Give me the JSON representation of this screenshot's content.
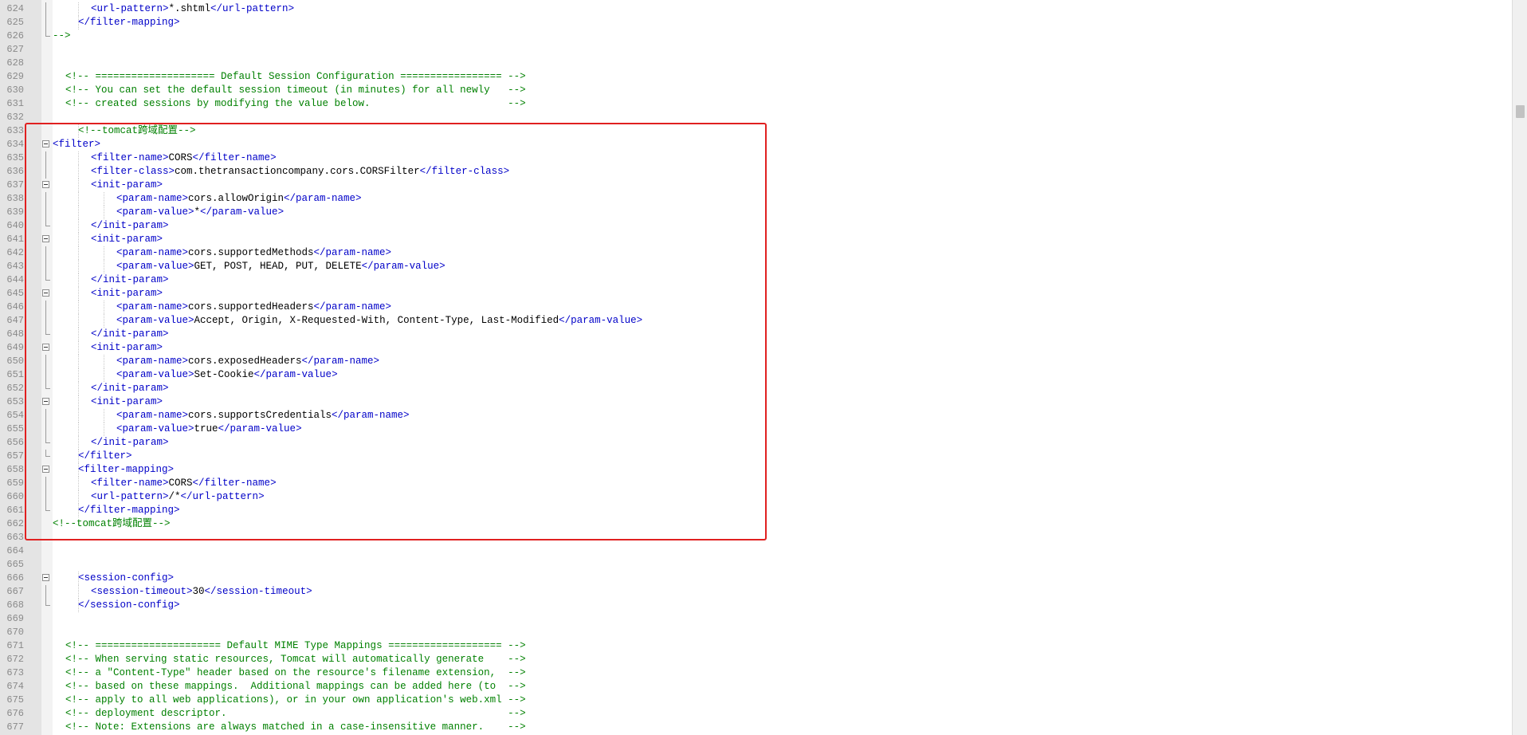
{
  "lines": [
    {
      "n": "624",
      "indent": 3,
      "fold": "line",
      "tokens": [
        [
          "tag",
          "<url-pattern>"
        ],
        [
          "text",
          "*.shtml"
        ],
        [
          "tag",
          "</url-pattern>"
        ]
      ]
    },
    {
      "n": "625",
      "indent": 2,
      "fold": "line",
      "tokens": [
        [
          "tag",
          "</filter-mapping>"
        ]
      ]
    },
    {
      "n": "626",
      "indent": 0,
      "fold": "end",
      "tokens": [
        [
          "comment",
          "-->"
        ]
      ]
    },
    {
      "n": "627",
      "indent": 0,
      "fold": "none",
      "tokens": []
    },
    {
      "n": "628",
      "indent": 0,
      "fold": "none",
      "tokens": []
    },
    {
      "n": "629",
      "indent": 1,
      "fold": "none",
      "tokens": [
        [
          "comment",
          "<!-- ==================== Default Session Configuration ================= -->"
        ]
      ]
    },
    {
      "n": "630",
      "indent": 1,
      "fold": "none",
      "tokens": [
        [
          "comment",
          "<!-- You can set the default session timeout (in minutes) for all newly   -->"
        ]
      ]
    },
    {
      "n": "631",
      "indent": 1,
      "fold": "none",
      "tokens": [
        [
          "comment",
          "<!-- created sessions by modifying the value below.                       -->"
        ]
      ]
    },
    {
      "n": "632",
      "indent": 0,
      "fold": "none",
      "tokens": []
    },
    {
      "n": "633",
      "indent": 2,
      "fold": "none",
      "tokens": [
        [
          "comment",
          "<!--tomcat跨域配置-->"
        ]
      ]
    },
    {
      "n": "634",
      "indent": 0,
      "fold": "box",
      "tokens": [
        [
          "tag",
          "<filter>"
        ]
      ]
    },
    {
      "n": "635",
      "indent": 3,
      "fold": "line",
      "tokens": [
        [
          "tag",
          "<filter-name>"
        ],
        [
          "text",
          "CORS"
        ],
        [
          "tag",
          "</filter-name>"
        ]
      ]
    },
    {
      "n": "636",
      "indent": 3,
      "fold": "line",
      "tokens": [
        [
          "tag",
          "<filter-class>"
        ],
        [
          "text",
          "com.thetransactioncompany.cors.CORSFilter"
        ],
        [
          "tag",
          "</filter-class>"
        ]
      ]
    },
    {
      "n": "637",
      "indent": 3,
      "fold": "box",
      "tokens": [
        [
          "tag",
          "<init-param>"
        ]
      ]
    },
    {
      "n": "638",
      "indent": 5,
      "fold": "line",
      "tokens": [
        [
          "tag",
          "<param-name>"
        ],
        [
          "text",
          "cors.allowOrigin"
        ],
        [
          "tag",
          "</param-name>"
        ]
      ]
    },
    {
      "n": "639",
      "indent": 5,
      "fold": "line",
      "tokens": [
        [
          "tag",
          "<param-value>"
        ],
        [
          "text",
          "*"
        ],
        [
          "tag",
          "</param-value>"
        ]
      ]
    },
    {
      "n": "640",
      "indent": 3,
      "fold": "end",
      "tokens": [
        [
          "tag",
          "</init-param>"
        ]
      ]
    },
    {
      "n": "641",
      "indent": 3,
      "fold": "box",
      "tokens": [
        [
          "tag",
          "<init-param>"
        ]
      ]
    },
    {
      "n": "642",
      "indent": 5,
      "fold": "line",
      "tokens": [
        [
          "tag",
          "<param-name>"
        ],
        [
          "text",
          "cors.supportedMethods"
        ],
        [
          "tag",
          "</param-name>"
        ]
      ]
    },
    {
      "n": "643",
      "indent": 5,
      "fold": "line",
      "tokens": [
        [
          "tag",
          "<param-value>"
        ],
        [
          "text",
          "GET, POST, HEAD, PUT, DELETE"
        ],
        [
          "tag",
          "</param-value>"
        ]
      ]
    },
    {
      "n": "644",
      "indent": 3,
      "fold": "end",
      "tokens": [
        [
          "tag",
          "</init-param>"
        ]
      ]
    },
    {
      "n": "645",
      "indent": 3,
      "fold": "box",
      "tokens": [
        [
          "tag",
          "<init-param>"
        ]
      ]
    },
    {
      "n": "646",
      "indent": 5,
      "fold": "line",
      "tokens": [
        [
          "tag",
          "<param-name>"
        ],
        [
          "text",
          "cors.supportedHeaders"
        ],
        [
          "tag",
          "</param-name>"
        ]
      ]
    },
    {
      "n": "647",
      "indent": 5,
      "fold": "line",
      "tokens": [
        [
          "tag",
          "<param-value>"
        ],
        [
          "text",
          "Accept, Origin, X-Requested-With, Content-Type, Last-Modified"
        ],
        [
          "tag",
          "</param-value>"
        ]
      ]
    },
    {
      "n": "648",
      "indent": 3,
      "fold": "end",
      "tokens": [
        [
          "tag",
          "</init-param>"
        ]
      ]
    },
    {
      "n": "649",
      "indent": 3,
      "fold": "box",
      "tokens": [
        [
          "tag",
          "<init-param>"
        ]
      ]
    },
    {
      "n": "650",
      "indent": 5,
      "fold": "line",
      "tokens": [
        [
          "tag",
          "<param-name>"
        ],
        [
          "text",
          "cors.exposedHeaders"
        ],
        [
          "tag",
          "</param-name>"
        ]
      ]
    },
    {
      "n": "651",
      "indent": 5,
      "fold": "line",
      "tokens": [
        [
          "tag",
          "<param-value>"
        ],
        [
          "text",
          "Set-Cookie"
        ],
        [
          "tag",
          "</param-value>"
        ]
      ]
    },
    {
      "n": "652",
      "indent": 3,
      "fold": "end",
      "tokens": [
        [
          "tag",
          "</init-param>"
        ]
      ]
    },
    {
      "n": "653",
      "indent": 3,
      "fold": "box",
      "tokens": [
        [
          "tag",
          "<init-param>"
        ]
      ]
    },
    {
      "n": "654",
      "indent": 5,
      "fold": "line",
      "tokens": [
        [
          "tag",
          "<param-name>"
        ],
        [
          "text",
          "cors.supportsCredentials"
        ],
        [
          "tag",
          "</param-name>"
        ]
      ]
    },
    {
      "n": "655",
      "indent": 5,
      "fold": "line",
      "tokens": [
        [
          "tag",
          "<param-value>"
        ],
        [
          "text",
          "true"
        ],
        [
          "tag",
          "</param-value>"
        ]
      ]
    },
    {
      "n": "656",
      "indent": 3,
      "fold": "end",
      "tokens": [
        [
          "tag",
          "</init-param>"
        ]
      ]
    },
    {
      "n": "657",
      "indent": 2,
      "fold": "end",
      "tokens": [
        [
          "tag",
          "</filter>"
        ]
      ]
    },
    {
      "n": "658",
      "indent": 2,
      "fold": "box",
      "tokens": [
        [
          "tag",
          "<filter-mapping>"
        ]
      ]
    },
    {
      "n": "659",
      "indent": 3,
      "fold": "line",
      "tokens": [
        [
          "tag",
          "<filter-name>"
        ],
        [
          "text",
          "CORS"
        ],
        [
          "tag",
          "</filter-name>"
        ]
      ]
    },
    {
      "n": "660",
      "indent": 3,
      "fold": "line",
      "tokens": [
        [
          "tag",
          "<url-pattern>"
        ],
        [
          "text",
          "/*"
        ],
        [
          "tag",
          "</url-pattern>"
        ]
      ]
    },
    {
      "n": "661",
      "indent": 2,
      "fold": "end",
      "tokens": [
        [
          "tag",
          "</filter-mapping>"
        ]
      ]
    },
    {
      "n": "662",
      "indent": 0,
      "fold": "none",
      "tokens": [
        [
          "comment",
          "<!--tomcat跨域配置-->"
        ]
      ]
    },
    {
      "n": "663",
      "indent": 0,
      "fold": "none",
      "tokens": []
    },
    {
      "n": "664",
      "indent": 0,
      "fold": "none",
      "tokens": []
    },
    {
      "n": "665",
      "indent": 0,
      "fold": "none",
      "tokens": []
    },
    {
      "n": "666",
      "indent": 2,
      "fold": "box",
      "tokens": [
        [
          "tag",
          "<session-config>"
        ]
      ]
    },
    {
      "n": "667",
      "indent": 3,
      "fold": "line",
      "tokens": [
        [
          "tag",
          "<session-timeout>"
        ],
        [
          "text",
          "30"
        ],
        [
          "tag",
          "</session-timeout>"
        ]
      ]
    },
    {
      "n": "668",
      "indent": 2,
      "fold": "end",
      "tokens": [
        [
          "tag",
          "</session-config>"
        ]
      ]
    },
    {
      "n": "669",
      "indent": 0,
      "fold": "none",
      "tokens": []
    },
    {
      "n": "670",
      "indent": 0,
      "fold": "none",
      "tokens": []
    },
    {
      "n": "671",
      "indent": 1,
      "fold": "none",
      "tokens": [
        [
          "comment",
          "<!-- ===================== Default MIME Type Mappings =================== -->"
        ]
      ]
    },
    {
      "n": "672",
      "indent": 1,
      "fold": "none",
      "tokens": [
        [
          "comment",
          "<!-- When serving static resources, Tomcat will automatically generate    -->"
        ]
      ]
    },
    {
      "n": "673",
      "indent": 1,
      "fold": "none",
      "tokens": [
        [
          "comment",
          "<!-- a \"Content-Type\" header based on the resource's filename extension,  -->"
        ]
      ]
    },
    {
      "n": "674",
      "indent": 1,
      "fold": "none",
      "tokens": [
        [
          "comment",
          "<!-- based on these mappings.  Additional mappings can be added here (to  -->"
        ]
      ]
    },
    {
      "n": "675",
      "indent": 1,
      "fold": "none",
      "tokens": [
        [
          "comment",
          "<!-- apply to all web applications), or in your own application's web.xml -->"
        ]
      ]
    },
    {
      "n": "676",
      "indent": 1,
      "fold": "none",
      "tokens": [
        [
          "comment",
          "<!-- deployment descriptor.                                               -->"
        ]
      ]
    },
    {
      "n": "677",
      "indent": 1,
      "fold": "none",
      "tokens": [
        [
          "comment",
          "<!-- Note: Extensions are always matched in a case-insensitive manner.    -->"
        ]
      ]
    }
  ],
  "colors": {
    "tag": "#0000c8",
    "text": "#000000",
    "comment": "#008000",
    "highlight": "#e02020"
  }
}
